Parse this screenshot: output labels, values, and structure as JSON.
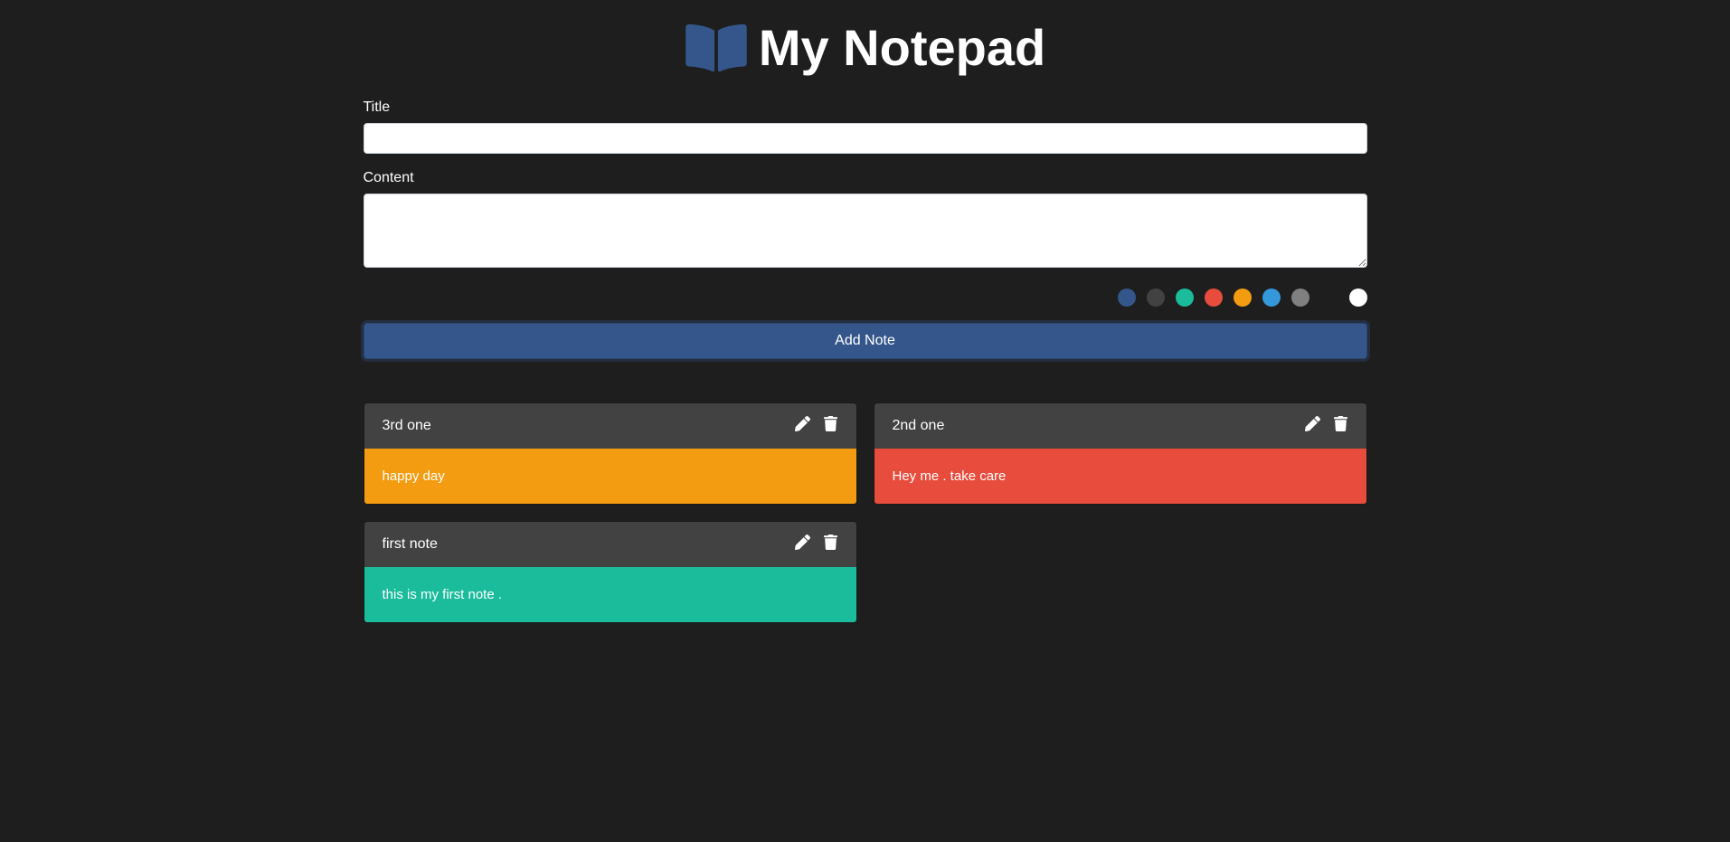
{
  "header": {
    "title": "My Notepad"
  },
  "form": {
    "title_label": "Title",
    "title_value": "",
    "content_label": "Content",
    "content_value": "",
    "add_button": "Add Note"
  },
  "colors": [
    {
      "name": "blue",
      "hex": "#34568b"
    },
    {
      "name": "dark-grey",
      "hex": "#424242"
    },
    {
      "name": "green",
      "hex": "#1abc9c"
    },
    {
      "name": "red",
      "hex": "#e74c3c"
    },
    {
      "name": "orange",
      "hex": "#f39c12"
    },
    {
      "name": "light-blue",
      "hex": "#3498db"
    },
    {
      "name": "grey",
      "hex": "#808080"
    },
    {
      "name": "black",
      "hex": "#1e1e1e"
    },
    {
      "name": "white",
      "hex": "#ffffff"
    }
  ],
  "notes": [
    {
      "title": "3rd one",
      "content": "happy day",
      "color": "#f39c12"
    },
    {
      "title": "2nd one",
      "content": "Hey me . take care",
      "color": "#e74c3c"
    },
    {
      "title": "first note",
      "content": "this is my first note .",
      "color": "#1abc9c"
    }
  ]
}
